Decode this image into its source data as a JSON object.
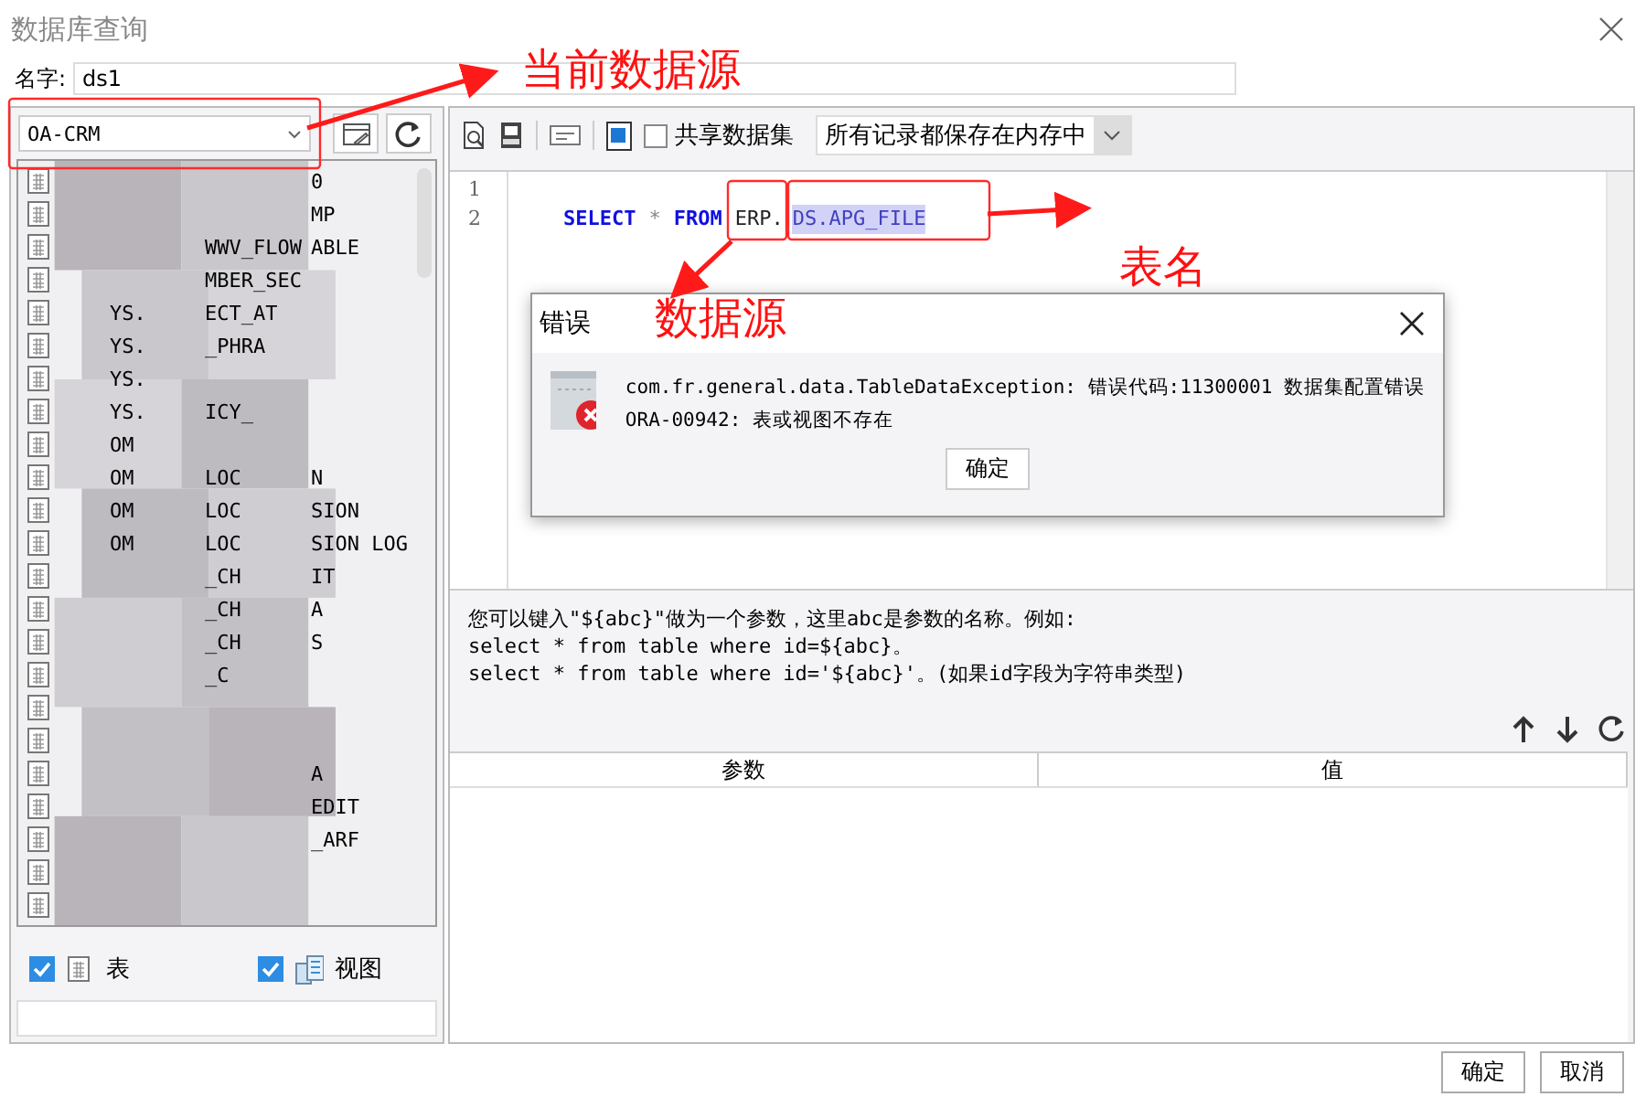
{
  "window": {
    "title": "数据库查询"
  },
  "name_field": {
    "label": "名字:",
    "value": "ds1"
  },
  "datasource": {
    "value": "OA-CRM"
  },
  "table_list": {
    "rows": [
      {
        "kind": "table",
        "col_3": "0"
      },
      {
        "kind": "table",
        "col_3": "MP"
      },
      {
        "kind": "table",
        "col_2": "WWV_FLOW",
        "col_3": "ABLE"
      },
      {
        "kind": "table",
        "col_2": "MBER_SEC"
      },
      {
        "kind": "table",
        "col_1": "YS.",
        "col_2": "ECT_AT"
      },
      {
        "kind": "table",
        "col_1": "YS.",
        "col_2": "_PHRA"
      },
      {
        "kind": "table",
        "col_1": "YS."
      },
      {
        "kind": "table",
        "col_1": "YS.",
        "col_2": "ICY_"
      },
      {
        "kind": "table",
        "col_1": "OM"
      },
      {
        "kind": "table",
        "col_1": "OM",
        "col_2": "LOC",
        "col_3": "N"
      },
      {
        "kind": "table",
        "col_1": "OM",
        "col_2": "LOC",
        "col_3": "SION"
      },
      {
        "kind": "table",
        "col_1": "OM",
        "col_2": "LOC",
        "col_3": "SION LOG"
      },
      {
        "kind": "table",
        "col_2": "_CH",
        "col_3": "IT"
      },
      {
        "kind": "table",
        "col_2": "_CH",
        "col_3": "A"
      },
      {
        "kind": "table",
        "col_2": "_CH",
        "col_3": "S"
      },
      {
        "kind": "table",
        "col_2": "_C"
      },
      {
        "kind": "table"
      },
      {
        "kind": "table"
      },
      {
        "kind": "table",
        "col_3": "A"
      },
      {
        "kind": "table",
        "col_3": "EDIT"
      },
      {
        "kind": "table",
        "col_3": "_ARF"
      },
      {
        "kind": "table"
      },
      {
        "kind": "table"
      }
    ]
  },
  "filters": [
    {
      "kind": "table",
      "label": "表",
      "checked": true
    },
    {
      "kind": "view",
      "label": "视图",
      "checked": true
    }
  ],
  "toolbar": {
    "share_dataset": {
      "label": "共享数据集",
      "checked": false
    },
    "storage_mode": {
      "value": "所有记录都保存在内存中"
    }
  },
  "editor": {
    "line_numbers": [
      "1",
      "2"
    ],
    "tokens": [
      {
        "text": "SELECT",
        "kind": "keyword",
        "selected": false
      },
      {
        "text": "*",
        "kind": "operator",
        "selected": false
      },
      {
        "text": "FROM",
        "kind": "keyword",
        "selected": false
      },
      {
        "text": "ERP.",
        "kind": "identifier",
        "selected": false
      },
      {
        "text": "DS.APG_FILE",
        "kind": "identifier",
        "selected": true
      }
    ]
  },
  "hint": {
    "lines": [
      "您可以键入\"${abc}\"做为一个参数，这里abc是参数的名称。例如:",
      "select * from table where id=${abc}。",
      "select * from table where id='${abc}'。(如果id字段为字符串类型)"
    ]
  },
  "param_table": {
    "columns": [
      "参数",
      "值"
    ]
  },
  "error_dialog": {
    "title": "错误",
    "message_lines": [
      "com.fr.general.data.TableDataException: 错误代码:11300001 数据集配置错误",
      "ORA-00942: 表或视图不存在"
    ],
    "button": "确定"
  },
  "annotations": [
    {
      "text": "当前数据源"
    },
    {
      "text": "表名"
    },
    {
      "text": "数据源"
    }
  ],
  "buttons": [
    "确定",
    "取消"
  ]
}
